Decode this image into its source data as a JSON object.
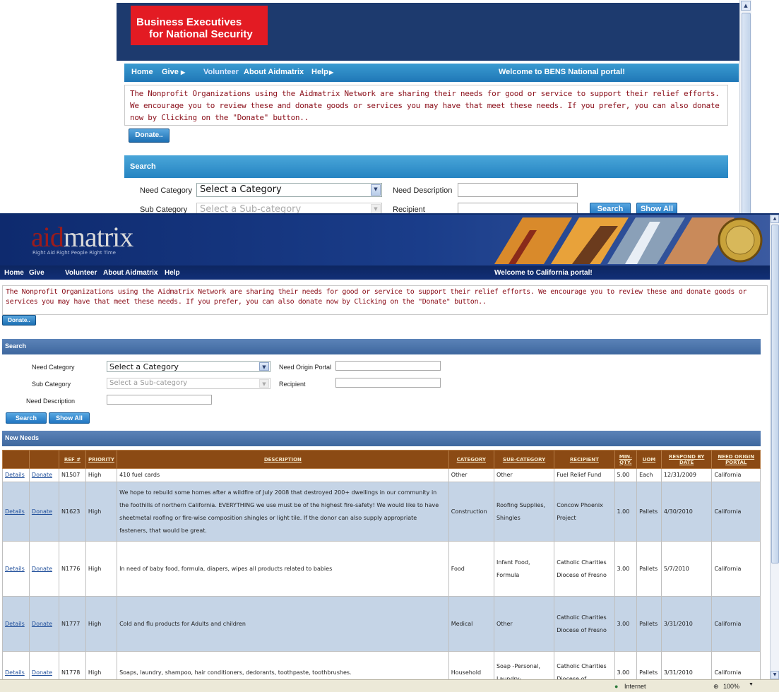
{
  "bens": {
    "logo_line1": "Business Executives",
    "logo_line2": "for National Security",
    "nav": [
      "Home",
      "Give",
      "Volunteer",
      "About Aidmatrix",
      "Help"
    ],
    "welcome": "Welcome to BENS National portal!",
    "intro": "The Nonprofit Organizations using the Aidmatrix Network are sharing their needs for good or service to support their relief efforts. We encourage you to review these and donate goods or services you may have that meet these needs. If you prefer, you can also donate now by Clicking on the \"Donate\" button..",
    "donate_label": "Donate..",
    "search_title": "Search",
    "need_category_label": "Need Category",
    "need_category_value": "Select a Category",
    "need_description_label": "Need Description",
    "sub_category_label": "Sub Category",
    "sub_category_value": "Select a Sub-category",
    "recipient_label": "Recipient",
    "search_label": "Search",
    "show_all_label": "Show All"
  },
  "ca": {
    "logo_red": "aid",
    "logo_grey": "matrix",
    "tagline": "Right Aid Right People Right Time",
    "nav": [
      "Home",
      "Give",
      "Volunteer",
      "About Aidmatrix",
      "Help"
    ],
    "welcome": "Welcome to California portal!",
    "intro": "The Nonprofit Organizations using the Aidmatrix Network are sharing their needs for good or service to support their relief efforts. We encourage you to review these and donate goods or services you may have that meet these needs. If you prefer, you can also donate now by Clicking on the \"Donate\" button..",
    "donate_label": "Donate..",
    "search_title": "Search",
    "need_category_label": "Need Category",
    "need_category_value": "Select a Category",
    "need_origin_label": "Need Origin Portal",
    "sub_category_label": "Sub Category",
    "sub_category_value": "Select a Sub-category",
    "recipient_label": "Recipient",
    "need_description_label": "Need Description",
    "search_label": "Search",
    "show_all_label": "Show All",
    "new_needs_title": "New Needs",
    "columns": [
      "",
      "",
      "Ref #",
      "Priority",
      "Description",
      "Category",
      "Sub-Category",
      "Recipient",
      "Min. Qty.",
      "UOM",
      "Respond By Date",
      "Need Origin Portal"
    ],
    "rows": [
      {
        "details": "Details",
        "donate": "Donate",
        "ref": "N1507",
        "priority": "High",
        "description": "410 fuel cards",
        "category": "Other",
        "subcategory": "Other",
        "recipient": "Fuel Relief Fund",
        "qty": "5.00",
        "uom": "Each",
        "date": "12/31/2009",
        "portal": "California"
      },
      {
        "details": "Details",
        "donate": "Donate",
        "ref": "N1623",
        "priority": "High",
        "description": "We hope to rebuild some homes after a wildfire of July 2008 that destroyed 200+ dwellings in our community in the foothills of northern California. EVERYTHING we use must be of the highest fire-safety! We would like to have sheetmetal roofing or fire-wise composition shingles or light tile. If the donor can also supply appropriate fasteners, that would be great.",
        "category": "Construction",
        "subcategory": "Roofing Supplies, Shingles",
        "recipient": "Concow Phoenix Project",
        "qty": "1.00",
        "uom": "Pallets",
        "date": "4/30/2010",
        "portal": "California"
      },
      {
        "details": "Details",
        "donate": "Donate",
        "ref": "N1776",
        "priority": "High",
        "description": "In need of baby food, formula, diapers, wipes all products related to babies",
        "category": "Food",
        "subcategory": "Infant Food, Formula",
        "recipient": "Catholic Charities Diocese of Fresno",
        "qty": "3.00",
        "uom": "Pallets",
        "date": "5/7/2010",
        "portal": "California"
      },
      {
        "details": "Details",
        "donate": "Donate",
        "ref": "N1777",
        "priority": "High",
        "description": "Cold and flu products for Adults and children",
        "category": "Medical",
        "subcategory": "Other",
        "recipient": "Catholic Charities Diocese of Fresno",
        "qty": "3.00",
        "uom": "Pallets",
        "date": "3/31/2010",
        "portal": "California"
      },
      {
        "details": "Details",
        "donate": "Donate",
        "ref": "N1778",
        "priority": "High",
        "description": "Soaps, laundry, shampoo, hair conditioners, dedorants, toothpaste, toothbrushes.",
        "category": "Household",
        "subcategory": "Soap -Personal, Laundry-,",
        "recipient": "Catholic Charities Diocese of",
        "qty": "3.00",
        "uom": "Pallets",
        "date": "3/31/2010",
        "portal": "California"
      }
    ],
    "status_zone": "Internet",
    "zoom": "100%"
  }
}
